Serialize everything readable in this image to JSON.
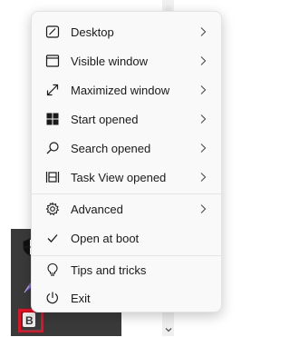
{
  "menu": {
    "items": [
      {
        "label": "Desktop",
        "icon": "desktop-icon",
        "submenu": true
      },
      {
        "label": "Visible window",
        "icon": "visible-window-icon",
        "submenu": true
      },
      {
        "label": "Maximized window",
        "icon": "maximize-icon",
        "submenu": true
      },
      {
        "label": "Start opened",
        "icon": "windows-start-icon",
        "submenu": true
      },
      {
        "label": "Search opened",
        "icon": "search-icon",
        "submenu": true
      },
      {
        "label": "Task View opened",
        "icon": "task-view-icon",
        "submenu": true
      },
      {
        "label": "Advanced",
        "icon": "gear-icon",
        "submenu": true
      },
      {
        "label": "Open at boot",
        "icon": "checkmark-icon",
        "checked": true
      },
      {
        "label": "Tips and tricks",
        "icon": "lightbulb-icon"
      },
      {
        "label": "Exit",
        "icon": "power-icon"
      }
    ]
  },
  "tray": {
    "icons": [
      "shield-icon",
      "feather-icon",
      "app-b-icon"
    ],
    "highlight_color": "#e81123"
  },
  "colors": {
    "menu_bg": "#f9f9f9",
    "text": "#1a1a1a",
    "tray_bg": "#3a3a3a",
    "highlight": "#e81123"
  }
}
